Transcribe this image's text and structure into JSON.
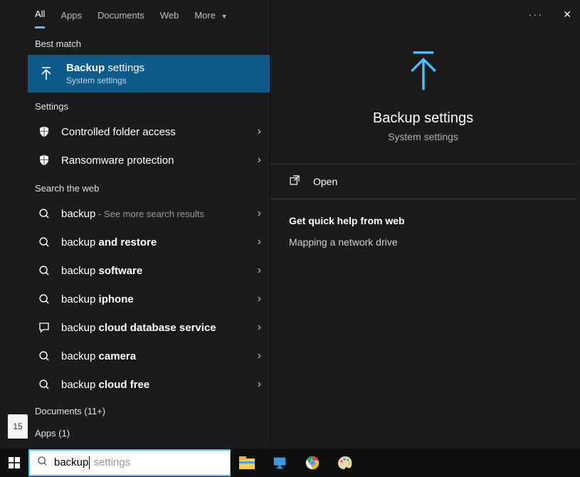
{
  "tabs": {
    "all": "All",
    "apps": "Apps",
    "documents": "Documents",
    "web": "Web",
    "more": "More"
  },
  "sections": {
    "best_match": "Best match",
    "settings": "Settings",
    "search_web": "Search the web",
    "documents_count": "Documents (11+)",
    "apps_count": "Apps (1)"
  },
  "best_match_item": {
    "title_bold": "Backup",
    "title_rest": " settings",
    "subtitle": "System settings"
  },
  "settings_items": [
    {
      "label": "Controlled folder access"
    },
    {
      "label": "Ransomware protection"
    }
  ],
  "web_items": [
    {
      "pre": "backup",
      "bold": "",
      "tail": " - See more search results",
      "tail_dim": true
    },
    {
      "pre": "backup ",
      "bold": "and restore",
      "tail": ""
    },
    {
      "pre": "backup ",
      "bold": "software",
      "tail": ""
    },
    {
      "pre": "backup ",
      "bold": "iphone",
      "tail": ""
    },
    {
      "pre": "backup ",
      "bold": "cloud database service",
      "tail": "",
      "chat": true
    },
    {
      "pre": "backup ",
      "bold": "camera",
      "tail": ""
    },
    {
      "pre": "backup ",
      "bold": "cloud free",
      "tail": ""
    }
  ],
  "detail": {
    "title": "Backup settings",
    "subtitle": "System settings",
    "open": "Open",
    "quick_help_title": "Get quick help from web",
    "quick_help_items": [
      "Mapping a network drive"
    ]
  },
  "searchbox": {
    "typed": "backup",
    "hint": " settings"
  },
  "notif": "15"
}
